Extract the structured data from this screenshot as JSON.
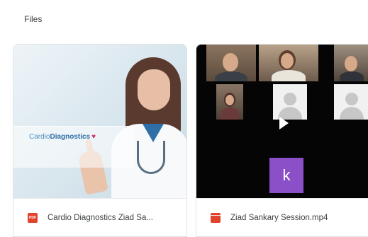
{
  "section": {
    "title": "Files"
  },
  "files": [
    {
      "name": "Cardio Diagnostics Ziad Sa...",
      "type_icon": "pdf-icon",
      "badge": "PDF",
      "thumbnail": {
        "brand_light": "Cardio",
        "brand_bold": "Diagnostics",
        "brand_heart": "♥"
      }
    },
    {
      "name": "Ziad Sankary Session.mp4",
      "type_icon": "video-file-icon",
      "thumbnail": {
        "participant_initial": "k"
      }
    }
  ],
  "colors": {
    "file_icon_red": "#e0442f",
    "participant_purple": "#8b4fc7"
  }
}
